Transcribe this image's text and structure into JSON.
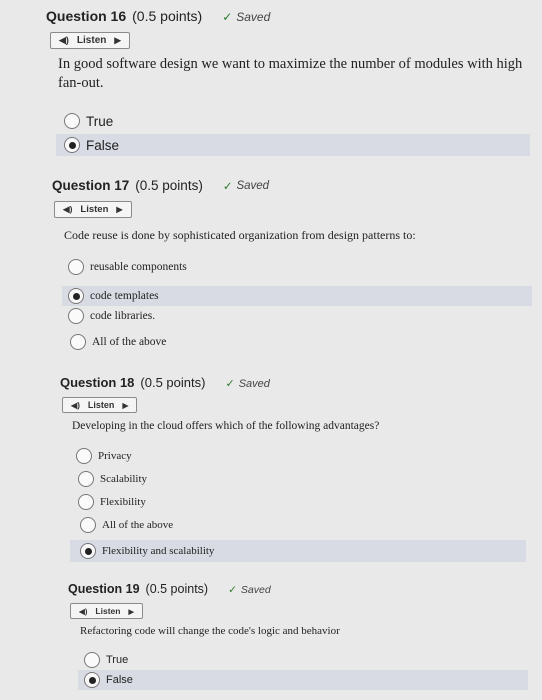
{
  "questions": [
    {
      "title": "Question 16",
      "points": "(0.5 points)",
      "saved": "Saved",
      "listen": "Listen",
      "prompt": "In good software design we want to maximize the number of modules with high fan-out.",
      "options": [
        {
          "label": "True",
          "selected": false
        },
        {
          "label": "False",
          "selected": true
        }
      ]
    },
    {
      "title": "Question 17",
      "points": "(0.5 points)",
      "saved": "Saved",
      "listen": "Listen",
      "prompt": "Code reuse is done by sophisticated organization from design patterns to:",
      "options": [
        {
          "label": "reusable components",
          "selected": false
        },
        {
          "label": "code templates",
          "selected": true
        },
        {
          "label": "code libraries.",
          "selected": false
        },
        {
          "label": "All of the above",
          "selected": false
        }
      ]
    },
    {
      "title": "Question 18",
      "points": "(0.5 points)",
      "saved": "Saved",
      "listen": "Listen",
      "prompt": "Developing in the cloud offers which of the following advantages?",
      "options": [
        {
          "label": "Privacy",
          "selected": false
        },
        {
          "label": "Scalability",
          "selected": false
        },
        {
          "label": "Flexibility",
          "selected": false
        },
        {
          "label": "All of the above",
          "selected": false
        },
        {
          "label": "Flexibility and scalability",
          "selected": true
        }
      ]
    },
    {
      "title": "Question 19",
      "points": "(0.5 points)",
      "saved": "Saved",
      "listen": "Listen",
      "prompt": "Refactoring code will change the code's logic and behavior",
      "options": [
        {
          "label": "True",
          "selected": false
        },
        {
          "label": "False",
          "selected": true
        }
      ]
    }
  ]
}
